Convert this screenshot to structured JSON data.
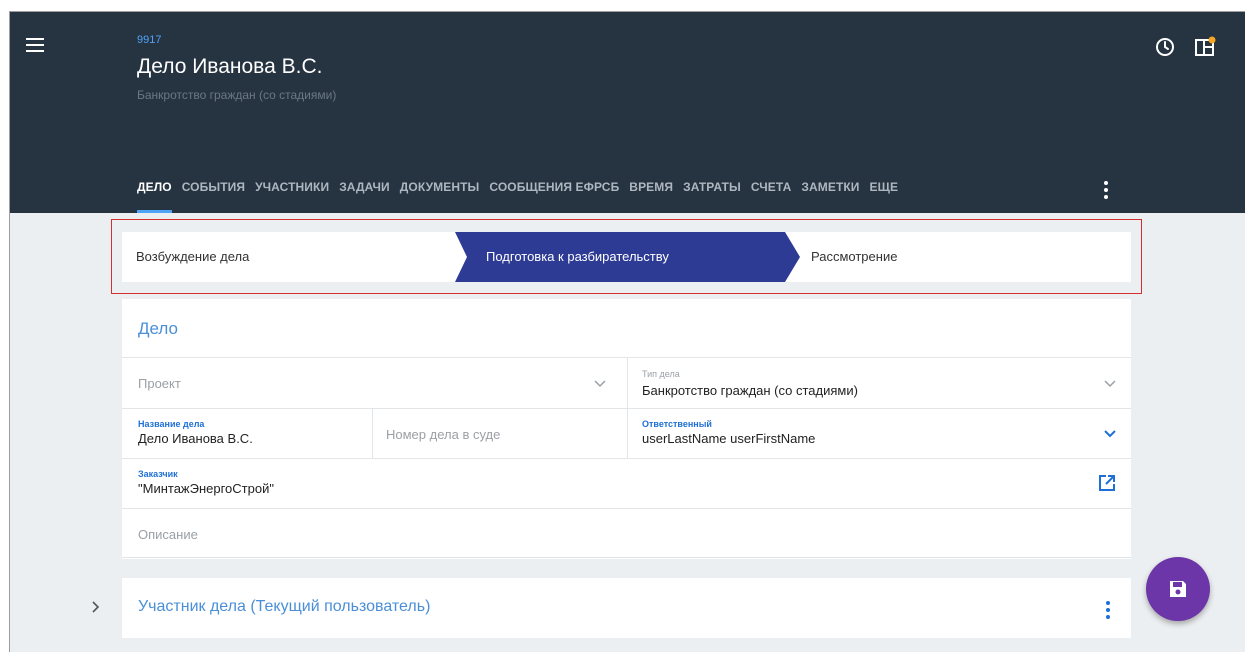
{
  "header": {
    "case_id": "9917",
    "case_title": "Дело Иванова В.С.",
    "case_type": "Банкротство граждан (со стадиями)",
    "icons": [
      "menu-icon",
      "clock-icon",
      "layout-icon"
    ]
  },
  "tabs": [
    {
      "label": "ДЕЛО",
      "active": true
    },
    {
      "label": "СОБЫТИЯ"
    },
    {
      "label": "УЧАСТНИКИ"
    },
    {
      "label": "ЗАДАЧИ"
    },
    {
      "label": "ДОКУМЕНТЫ"
    },
    {
      "label": "СООБЩЕНИЯ ЕФРСБ"
    },
    {
      "label": "ВРЕМЯ"
    },
    {
      "label": "ЗАТРАТЫ"
    },
    {
      "label": "СЧЕТА"
    },
    {
      "label": "ЗАМЕТКИ"
    },
    {
      "label": "ЕЩЕ"
    }
  ],
  "stages": {
    "items": [
      "Возбуждение дела",
      "Подготовка к разбирательству",
      "Рассмотрение"
    ],
    "active_index": 1,
    "active_color": "#2e3b95"
  },
  "form": {
    "title": "Дело",
    "project_placeholder": "Проект",
    "case_type_label": "Тип дела",
    "case_type_value": "Банкротство граждан (со стадиями)",
    "case_name_label": "Название дела",
    "case_name_value": "Дело Иванова В.С.",
    "court_number_placeholder": "Номер дела в суде",
    "responsible_label": "Ответственный",
    "responsible_value": "userLastName userFirstName",
    "customer_label": "Заказчик",
    "customer_value": "\"МинтажЭнергоСтрой\"",
    "description_placeholder": "Описание"
  },
  "participant": {
    "title": "Участник дела (Текущий пользователь)"
  },
  "colors": {
    "header_bg": "#263340",
    "accent_blue": "#1e70d6",
    "fab": "#6c35a8"
  }
}
